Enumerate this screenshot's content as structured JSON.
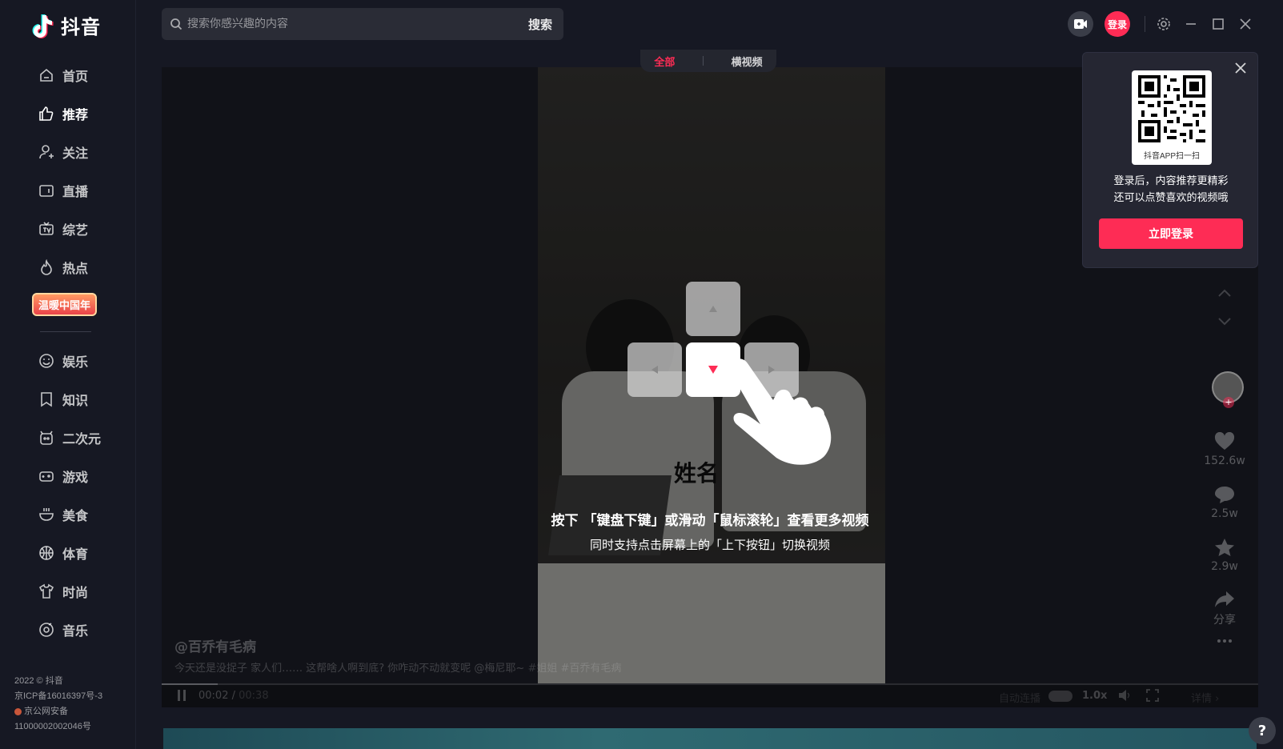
{
  "app": {
    "name": "抖音"
  },
  "search": {
    "placeholder": "搜索你感兴趣的内容",
    "button": "搜索"
  },
  "header": {
    "login": "登录"
  },
  "nav": {
    "home": "首页",
    "recommend": "推荐",
    "follow": "关注",
    "live": "直播",
    "variety": "综艺",
    "hot": "热点",
    "promo": "温暖中国年",
    "entertainment": "娱乐",
    "knowledge": "知识",
    "anime": "二次元",
    "games": "游戏",
    "food": "美食",
    "sports": "体育",
    "fashion": "时尚",
    "music": "音乐"
  },
  "footer": {
    "copyright": "2022 © 抖音",
    "icp": "京ICP备16016397号-3",
    "police": "京公网安备",
    "police_no": "11000002002046号"
  },
  "tabs": {
    "all": "全部",
    "landscape": "横视频"
  },
  "video": {
    "watermark": "姓名",
    "hint_main": "按下 「键盘下键」或滑动「鼠标滚轮」查看更多视频",
    "hint_sub": "同时支持点击屏幕上的「上下按钮」切换视频",
    "author": "@百乔有毛病",
    "description": "今天还是没捉子 家人们…… 这帮啥人啊到底? 你咋动不动就变呢 @梅尼耶~",
    "tags": "#姐姐  #百乔有毛病",
    "time_current": "00:02",
    "time_total": "00:38",
    "autoplay": "自动连播",
    "speed": "1.0x",
    "detail": "详情 ›"
  },
  "actions": {
    "likes": "152.6w",
    "comments": "2.5w",
    "favorites": "2.9w",
    "share": "分享"
  },
  "login_popup": {
    "qr_caption": "抖音APP扫一扫",
    "text1": "登录后，内容推荐更精彩",
    "text2": "还可以点赞喜欢的视频哦",
    "button": "立即登录"
  },
  "colors": {
    "accent": "#fe2c55",
    "background": "#161823"
  }
}
